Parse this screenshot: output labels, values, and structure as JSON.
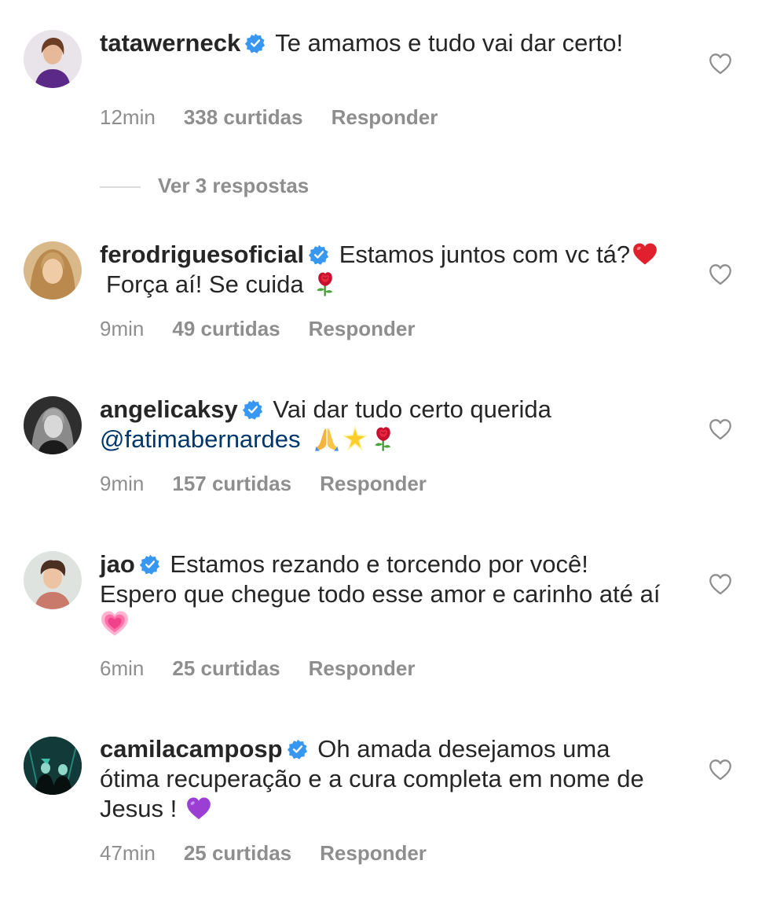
{
  "colors": {
    "text": "#262626",
    "muted": "#8e8e8e",
    "verified": "#3897f0",
    "mention": "#00376b"
  },
  "comments": [
    {
      "username": "tatawerneck",
      "text": "Te amamos e tudo vai dar certo!",
      "time": "12min",
      "likes": "338 curtidas",
      "reply": "Responder",
      "view_replies": "Ver 3 respostas"
    },
    {
      "username": "ferodriguesoficial",
      "text": "Estamos juntos com vc tá?",
      "text2": "Força aí! Se cuida",
      "emojis": [
        "red-heart",
        "rose"
      ],
      "time": "9min",
      "likes": "49 curtidas",
      "reply": "Responder"
    },
    {
      "username": "angelicaksy",
      "text": "Vai dar tudo certo querida",
      "mention": "@fatimabernardes",
      "emojis": [
        "folded-hands",
        "glowing-star",
        "rose"
      ],
      "time": "9min",
      "likes": "157 curtidas",
      "reply": "Responder"
    },
    {
      "username": "jao",
      "text": "Estamos rezando e torcendo por você! Espero que chegue todo esse amor e carinho até aí",
      "emojis": [
        "growing-heart"
      ],
      "time": "6min",
      "likes": "25 curtidas",
      "reply": "Responder"
    },
    {
      "username": "camilacamposp",
      "text": "Oh amada desejamos uma ótima recuperação e a cura completa em nome de Jesus !",
      "emojis": [
        "purple-heart"
      ],
      "time": "47min",
      "likes": "25 curtidas",
      "reply": "Responder"
    }
  ]
}
